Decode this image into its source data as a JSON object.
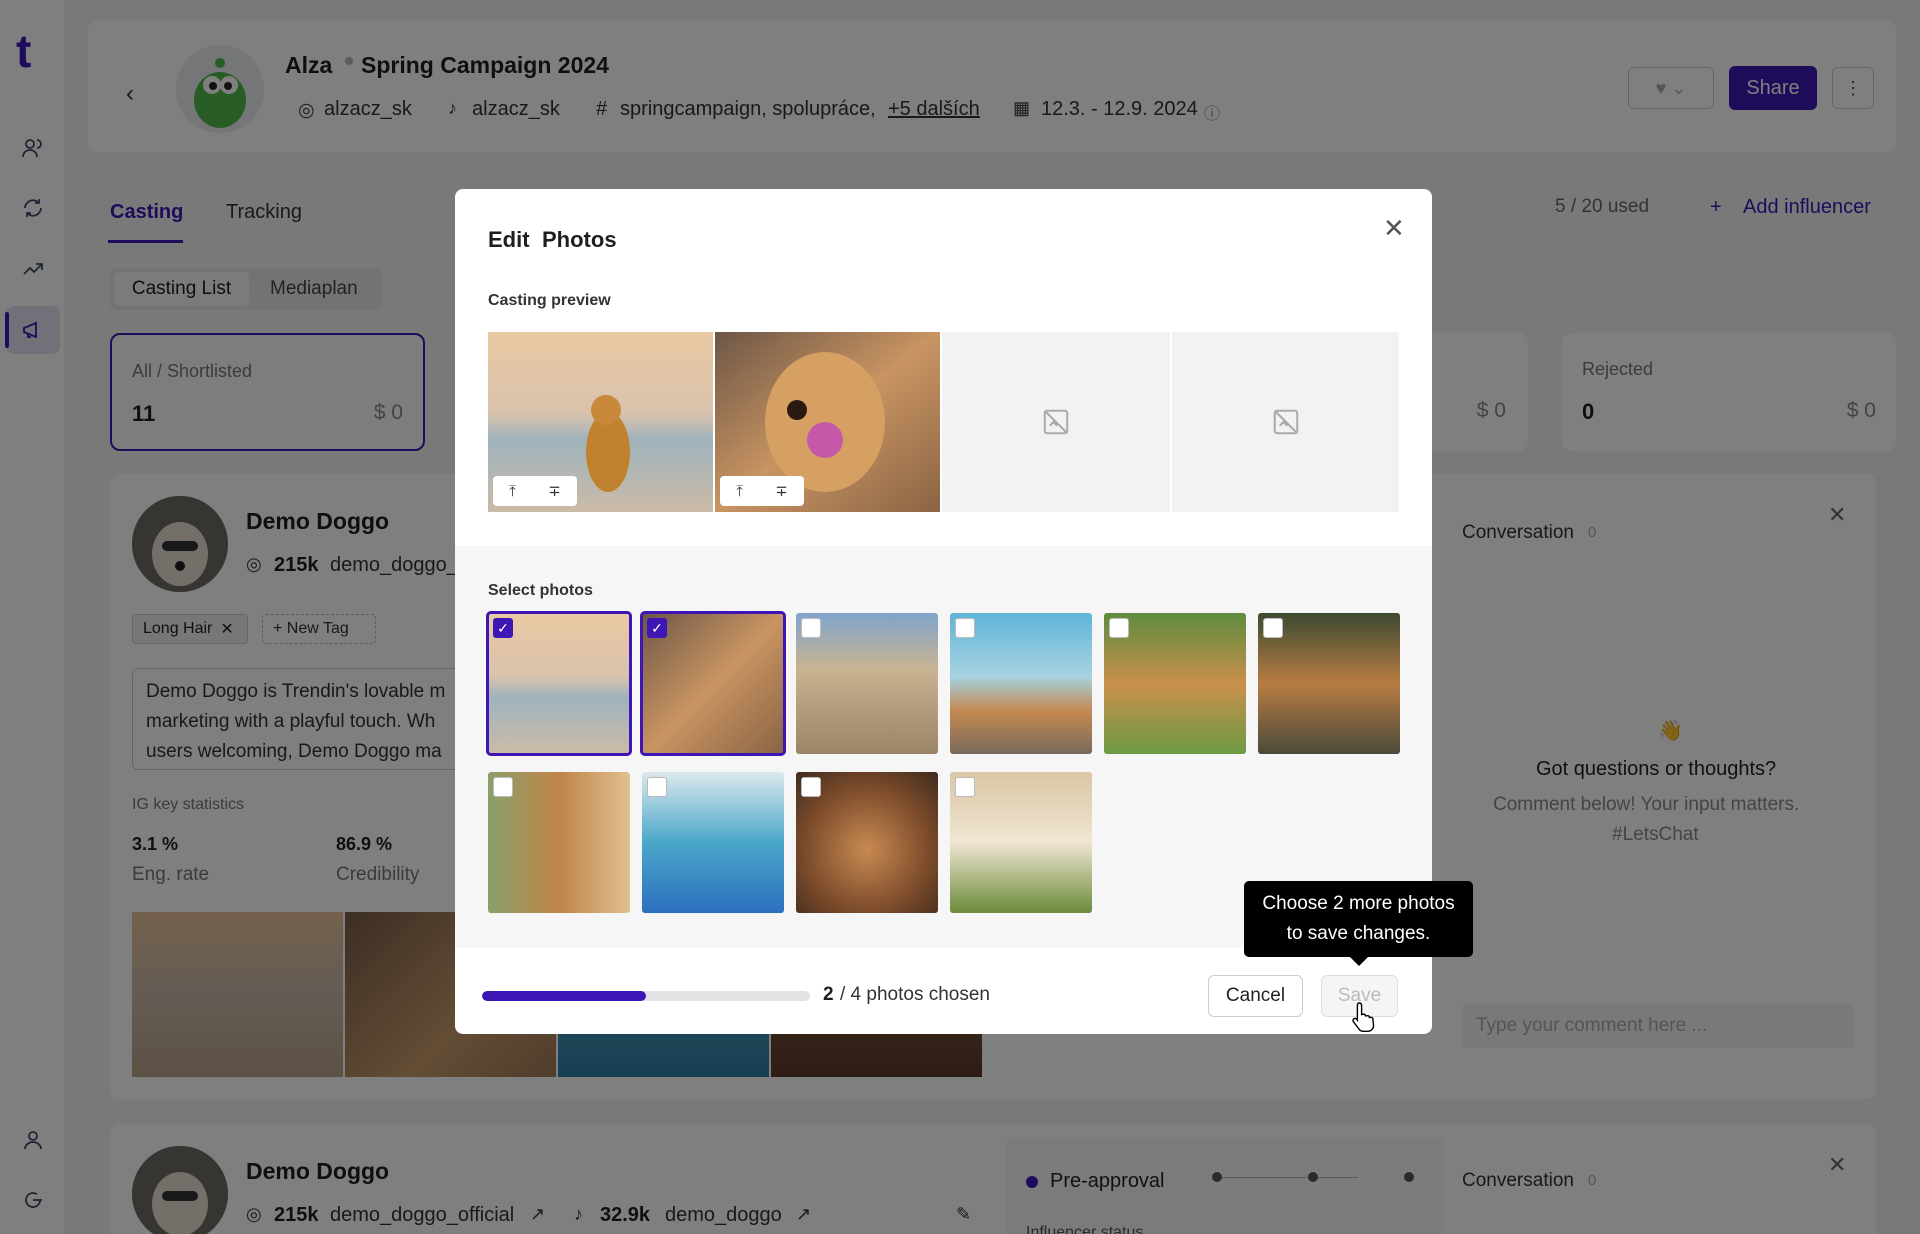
{
  "app": {
    "logo": "t",
    "header": {
      "brand": "Alza",
      "campaign": "Spring Campaign 2024",
      "instagram": "alzacz_sk",
      "tiktok": "alzacz_sk",
      "hashtags": "springcampaign, spolupráce,",
      "more_hashtags": "+5 dalších",
      "dates": "12.3. - 12.9. 2024",
      "share": "Share"
    },
    "tabs": [
      "Casting",
      "Tracking"
    ],
    "usage": "5 / 20 used",
    "add_influencer": "Add influencer",
    "subtabs": [
      "Casting List",
      "Mediaplan"
    ],
    "stats": {
      "all_label": "All / Shortlisted",
      "all_count": "11",
      "all_amount": "$ 0",
      "mid_amount": "$ 0",
      "rejected_label": "Rejected",
      "rejected_count": "0",
      "rejected_amount": "$ 0"
    },
    "influencer1": {
      "name": "Demo Doggo",
      "followers": "215k",
      "handle": "demo_doggo_",
      "tag": "Long Hair",
      "new_tag": "New Tag",
      "bio_lines": [
        "Demo Doggo is Trendin's lovable m",
        "marketing with a playful touch. Wh",
        "users welcoming, Demo Doggo ma"
      ],
      "stats_title": "IG key statistics",
      "eng_value": "3.1 %",
      "eng_label": "Eng. rate",
      "cred_value": "86.9 %",
      "cred_label": "Credibility"
    },
    "conversation": {
      "title": "Conversation",
      "count": "0",
      "emoji": "👋",
      "heading": "Got questions or thoughts?",
      "sub1": "Comment below! Your input matters.",
      "sub2": "#LetsChat",
      "placeholder": "Type your comment here ..."
    },
    "influencer2": {
      "name": "Demo Doggo",
      "followers": "215k",
      "handle": "demo_doggo_official",
      "tiktok_followers": "32.9k",
      "tiktok_handle": "demo_doggo",
      "status": "Pre-approval",
      "status_sub": "Influencer status",
      "conversation": "Conversation",
      "conversation_count": "0"
    }
  },
  "modal": {
    "title_a": "Edit",
    "title_b": "Photos",
    "preview_label": "Casting preview",
    "select_label": "Select photos",
    "progress": 0.5,
    "chosen_count": "2",
    "chosen_text": "/ 4 photos chosen",
    "cancel": "Cancel",
    "save": "Save",
    "tooltip_line1": "Choose 2 more photos",
    "tooltip_line2": "to save changes."
  },
  "colors": {
    "accent": "#3d16b5",
    "overlay": "rgba(0,0,0,0.5)"
  }
}
